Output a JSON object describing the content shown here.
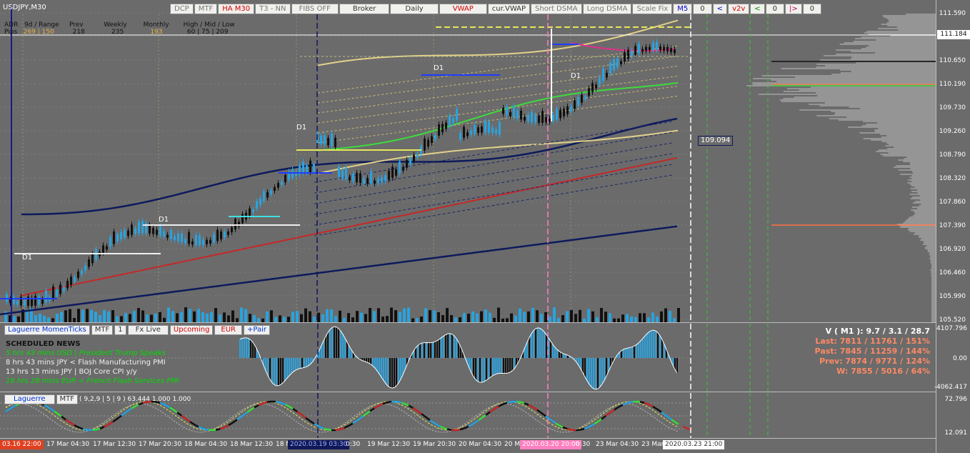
{
  "symbol": "USDJPY,M30",
  "adr": {
    "row1": [
      "ADR",
      "9d / Range",
      "Prev",
      "Weekly",
      "Monthly",
      "High / Mid / Low"
    ],
    "row2_label": "Pips",
    "row2": [
      "269 | 150",
      "218",
      "235",
      "193",
      "60  |  75  |  209"
    ]
  },
  "toolbar": [
    {
      "label": "DCP",
      "style": "gray"
    },
    {
      "label": "MTF",
      "style": "gray"
    },
    {
      "label": "HA M30",
      "style": "red"
    },
    {
      "label": "T3 - NN",
      "style": "gray"
    },
    {
      "label": "FIBS OFF",
      "style": "gray"
    },
    {
      "label": "Broker",
      "style": ""
    },
    {
      "label": "Daily",
      "style": ""
    },
    {
      "label": "VWAP",
      "style": "red"
    },
    {
      "label": "cur.VWAP",
      "style": ""
    },
    {
      "label": "Short DSMA",
      "style": "gray"
    },
    {
      "label": "Long DSMA",
      "style": "gray"
    },
    {
      "label": "Scale Fix",
      "style": "gray"
    },
    {
      "label": "M5",
      "style": "blue"
    },
    {
      "label": "0",
      "style": ""
    },
    {
      "label": "<",
      "style": "blue"
    },
    {
      "label": "v2v",
      "style": "red"
    },
    {
      "label": "<",
      "style": "green"
    },
    {
      "label": "0",
      "style": ""
    },
    {
      "label": "|>",
      "style": "pink"
    },
    {
      "label": "0",
      "style": ""
    }
  ],
  "d1_labels": [
    "D1",
    "D1",
    "D1",
    "D1",
    "D1"
  ],
  "price_ticks": [
    "111.590",
    "111.184",
    "110.650",
    "110.190",
    "109.730",
    "109.260",
    "108.790",
    "108.320",
    "107.860",
    "107.390",
    "106.920",
    "106.460",
    "105.990",
    "105.520"
  ],
  "current_price": "111.184",
  "level_box": "109.094",
  "osc_bar": [
    {
      "label": "Laguerre MomenTicks",
      "style": "blue"
    },
    {
      "label": "MTF",
      "style": ""
    },
    {
      "label": "1",
      "style": ""
    },
    {
      "label": "Fx Live",
      "style": ""
    },
    {
      "label": "Upcoming",
      "style": "red"
    },
    {
      "label": "EUR",
      "style": "red"
    },
    {
      "label": "+Pair",
      "style": "blue"
    }
  ],
  "news": {
    "title": "SCHEDULED NEWS",
    "items": [
      {
        "text": "5 hrs 43 mins  USD  |  President Trump Speaks",
        "color": "green"
      },
      {
        "text": "8 hrs 43 mins  JPY  <  Flash Manufacturing PMI",
        "color": "white"
      },
      {
        "text": "13 hrs 13 mins  JPY  |  BOJ Core CPI y/y",
        "color": "white"
      },
      {
        "text": "16 hrs 28 mins  EUR  <  French Flash Services PMI",
        "color": "green"
      }
    ]
  },
  "volume_stats": {
    "title": "V ( M1 ): 9.7 / 3.1 / 28.7",
    "lines": [
      "Last: 7811 / 11761 / 151%",
      "Past: 7845 / 11259 / 144%",
      "Prev: 7874 / 9771 / 124%",
      "W: 7855 / 5016 / 64%"
    ]
  },
  "osc_ticks": [
    "4107.796",
    "0.00",
    "-4062.417"
  ],
  "laguerre_bar": [
    {
      "label": "Laguerre",
      "style": "blue"
    },
    {
      "label": "MTF",
      "style": ""
    }
  ],
  "laguerre_params": "( 9,2,9 | 5 | 9 ) 63.444 1.000 1.000",
  "laguerre_ticks": [
    "72.796",
    "12.091"
  ],
  "time_labels": [
    "17 Mar 04:30",
    "17 Mar 12:30",
    "17 Mar 20:30",
    "18 Mar 04:30",
    "18 Mar 12:30",
    "18 M",
    "0:30",
    "19 Mar 12:30",
    "19 Mar 20:30",
    "20 Mar 04:30",
    "20 M",
    "0:30",
    "23 Mar 04:30",
    "23 Mar"
  ],
  "time_flags": [
    {
      "text": "03.16 22:00",
      "bg": "#e04020",
      "color": "#fff"
    },
    {
      "text": "2020.03.19 03:30",
      "bg": "#101858",
      "color": "#9fb0ff"
    },
    {
      "text": "2020.03.20 20:00",
      "bg": "#ff7fc0",
      "color": "#fff"
    },
    {
      "text": "2020.03.23 21:00",
      "bg": "#ffffff",
      "color": "#333"
    }
  ],
  "colors": {
    "background": "#6b6b6b",
    "candle_up": "#29a3e0",
    "candle_down": "#111111",
    "vwap_red": "#c62828",
    "navy_ma": "#0d1a5c",
    "band_gold": "#e2d18a",
    "ma_green": "#3ddc3d",
    "ma_magenta": "#e0308a"
  }
}
